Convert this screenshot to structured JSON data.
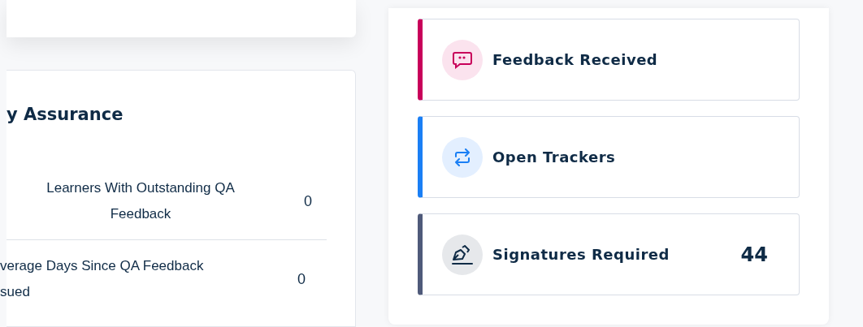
{
  "qa_card": {
    "title": "y Assurance",
    "rows": [
      {
        "lines": [
          "Learners With Outstanding QA",
          "Feedback"
        ],
        "kind": "centered",
        "value": "0"
      },
      {
        "lines": [
          "verage Days Since QA Feedback",
          "sued"
        ],
        "kind": "clipped",
        "value": "0"
      }
    ]
  },
  "tiles": [
    {
      "kind": "feedback",
      "label": "Feedback Received",
      "color": "#c8005a"
    },
    {
      "kind": "trackers",
      "label": "Open Trackers",
      "color": "#1a7ff5"
    },
    {
      "kind": "signatures",
      "label": "Signatures Required",
      "color": "#4f5a7a",
      "value": "44"
    }
  ]
}
